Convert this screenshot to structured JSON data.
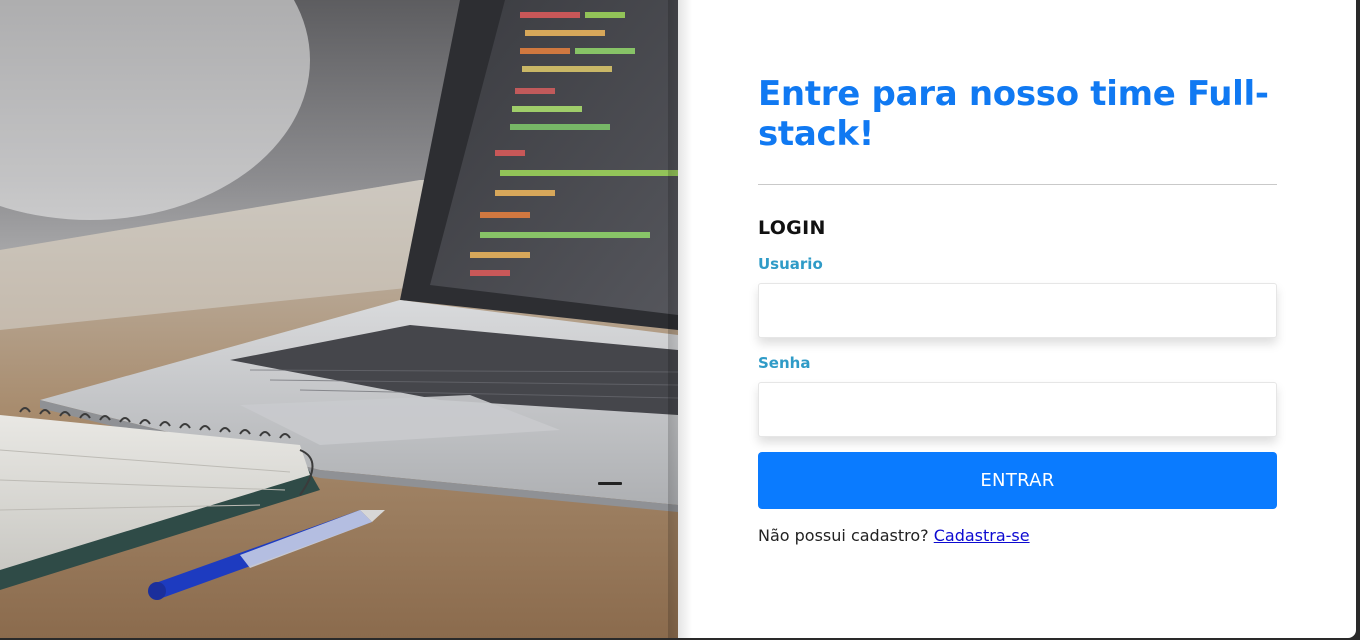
{
  "hero_image": {
    "description_icon": "laptop-desk-photo"
  },
  "form": {
    "title": "Entre para nosso time Full-stack!",
    "section_title": "LOGIN",
    "username_label": "Usuario",
    "username_value": "",
    "password_label": "Senha",
    "password_value": "",
    "submit_label": "ENTRAR",
    "signup_prompt": "Não possui cadastro?",
    "signup_link": "Cadastra-se"
  },
  "colors": {
    "title": "#1079f2",
    "label": "#2f9bc7",
    "button": "#0a7bff",
    "link": "#0d0ad1"
  }
}
